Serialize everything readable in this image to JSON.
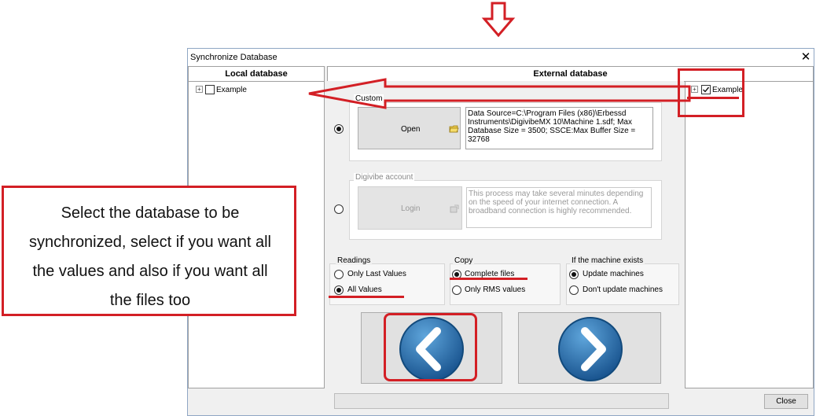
{
  "window": {
    "title": "Synchronize Database",
    "close_symbol": "✕"
  },
  "local_db": {
    "header": "Local database",
    "tree": [
      {
        "expander": "+",
        "label": "Example",
        "checked": false
      }
    ]
  },
  "external_db": {
    "header": "External database",
    "tree": [
      {
        "expander": "+",
        "label": "Example",
        "checked": true
      }
    ]
  },
  "custom": {
    "legend": "Custom",
    "open_label": "Open",
    "connection_text": "Data Source=C:\\Program Files (x86)\\Erbessd Instruments\\DigivibeMX 10\\Machine 1.sdf; Max Database Size = 3500; SSCE:Max Buffer Size = 32768"
  },
  "digivibe": {
    "legend": "Digivibe account",
    "login_label": "Login",
    "info_text": "This process may take several minutes depending on the speed of your internet connection. A broadband connection is highly recommended."
  },
  "readings": {
    "legend": "Readings",
    "options": [
      {
        "label": "Only Last Values",
        "selected": false
      },
      {
        "label": "All Values",
        "selected": true
      }
    ]
  },
  "copy": {
    "legend": "Copy",
    "options": [
      {
        "label": "Complete files",
        "selected": true
      },
      {
        "label": "Only RMS values",
        "selected": false
      }
    ]
  },
  "machine_exists": {
    "legend": "If the machine exists",
    "options": [
      {
        "label": "Update machines",
        "selected": true
      },
      {
        "label": "Don't update machines",
        "selected": false
      }
    ]
  },
  "footer": {
    "close_label": "Close"
  },
  "callout": {
    "text": "Select the database to be synchronized, select if you want all the values and also if you want all the files too"
  },
  "colors": {
    "annotation_red": "#d31f25",
    "arrow_blue": "#1f5f99"
  }
}
